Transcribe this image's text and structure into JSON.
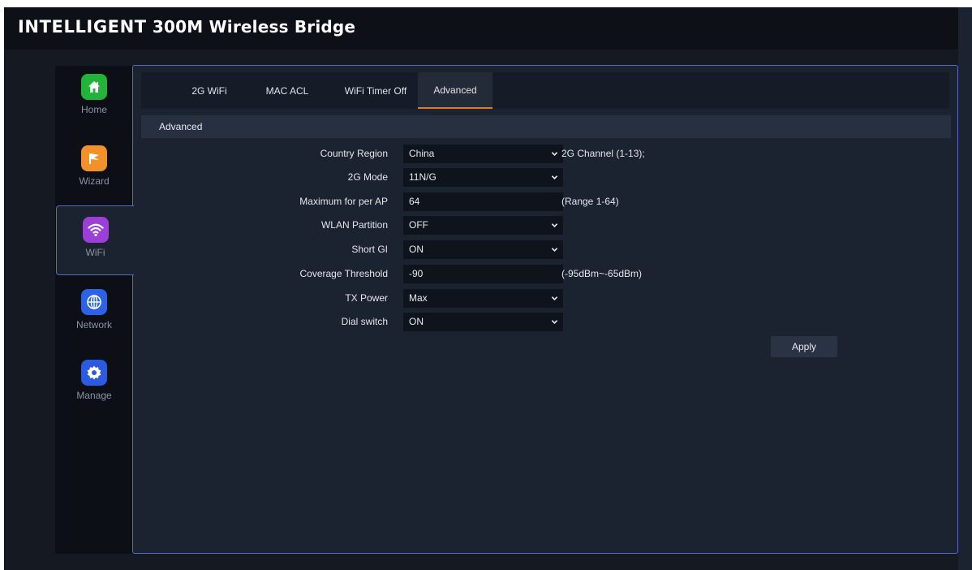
{
  "header": {
    "brand": "INTELLIGENT",
    "title_rest": "300M Wireless Bridge"
  },
  "sidebar": {
    "items": [
      {
        "label": "Home",
        "icon": "home-icon",
        "color": "#22b43a"
      },
      {
        "label": "Wizard",
        "icon": "flag-icon",
        "color": "#f0912a"
      },
      {
        "label": "WiFi",
        "icon": "wifi-icon",
        "color": "#9b3fd6",
        "active": true
      },
      {
        "label": "Network",
        "icon": "globe-icon",
        "color": "#2b62e8"
      },
      {
        "label": "Manage",
        "icon": "gear-icon",
        "color": "#2b5be0"
      }
    ]
  },
  "tabs": [
    {
      "label": "2G WiFi"
    },
    {
      "label": "MAC ACL"
    },
    {
      "label": "WiFi Timer Off"
    },
    {
      "label": "Advanced",
      "active": true
    }
  ],
  "section": {
    "title": "Advanced"
  },
  "form": {
    "country_region": {
      "label": "Country Region",
      "value": "China",
      "hint": "2G Channel (1-13);"
    },
    "mode": {
      "label": "2G Mode",
      "value": "11N/G"
    },
    "max_per_ap": {
      "label": "Maximum for per AP",
      "value": "64",
      "hint": "(Range 1-64)"
    },
    "wlan_partition": {
      "label": "WLAN Partition",
      "value": "OFF"
    },
    "short_gi": {
      "label": "Short GI",
      "value": "ON"
    },
    "coverage_threshold": {
      "label": "Coverage Threshold",
      "value": "-90",
      "hint": "(-95dBm~-65dBm)"
    },
    "tx_power": {
      "label": "TX Power",
      "value": "Max"
    },
    "dial_switch": {
      "label": "Dial switch",
      "value": "ON"
    }
  },
  "buttons": {
    "apply": "Apply"
  },
  "colors": {
    "accent": "#e07b1f",
    "border": "#5b6ab8"
  }
}
